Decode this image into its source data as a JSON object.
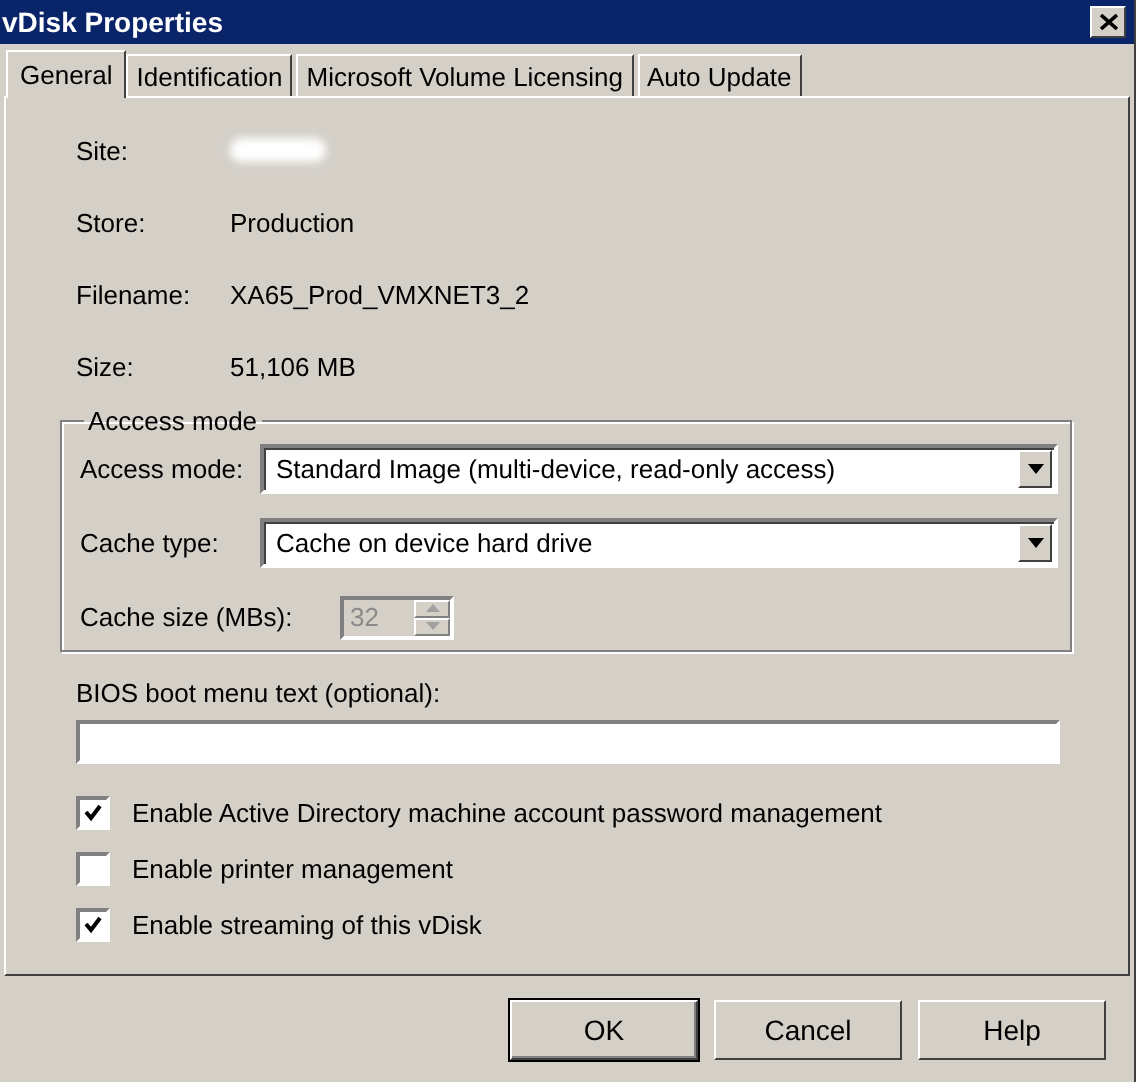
{
  "window": {
    "title": "vDisk Properties"
  },
  "tabs": [
    {
      "label": "General",
      "selected": true
    },
    {
      "label": "Identification",
      "selected": false
    },
    {
      "label": "Microsoft Volume Licensing",
      "selected": false
    },
    {
      "label": "Auto Update",
      "selected": false
    }
  ],
  "properties": [
    {
      "label": "Site:",
      "redacted": true
    },
    {
      "label": "Store:",
      "value": "Production"
    },
    {
      "label": "Filename:",
      "value": "XA65_Prod_VMXNET3_2"
    },
    {
      "label": "Size:",
      "value": "51,106 MB"
    }
  ],
  "access_group": {
    "title": "Acccess mode",
    "access_mode": {
      "label": "Access mode:",
      "value": "Standard Image (multi-device, read-only access)"
    },
    "cache_type": {
      "label": "Cache type:",
      "value": "Cache on device hard drive"
    },
    "cache_size": {
      "label": "Cache size (MBs):",
      "value": "32",
      "disabled": true
    }
  },
  "bios_text": {
    "label": "BIOS boot menu text (optional):"
  },
  "options": [
    {
      "label": "Enable Active Directory machine account password management",
      "checked": true
    },
    {
      "label": "Enable printer management",
      "checked": false
    },
    {
      "label": "Enable streaming of this vDisk",
      "checked": true
    }
  ],
  "buttons": [
    {
      "label": "OK",
      "default": true
    },
    {
      "label": "Cancel",
      "default": false
    },
    {
      "label": "Help",
      "default": false
    }
  ]
}
